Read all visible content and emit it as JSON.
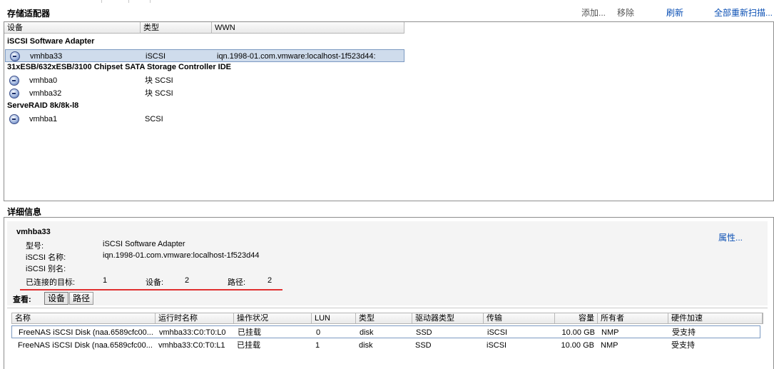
{
  "adapters_section": {
    "title": "存储适配器",
    "actions": {
      "add": "添加...",
      "remove": "移除",
      "refresh": "刷新",
      "rescan_all": "全部重新扫描..."
    },
    "columns": {
      "device": "设备",
      "type": "类型",
      "wwn": "WWN"
    },
    "groups": [
      {
        "name": "iSCSI Software Adapter",
        "rows": [
          {
            "device": "vmhba33",
            "type": "iSCSI",
            "wwn": "iqn.1998-01.com.vmware:localhost-1f523d44:"
          }
        ]
      },
      {
        "name": "31xESB/632xESB/3100 Chipset SATA Storage Controller IDE",
        "rows": [
          {
            "device": "vmhba0",
            "type": "块 SCSI",
            "wwn": ""
          },
          {
            "device": "vmhba32",
            "type": "块 SCSI",
            "wwn": ""
          }
        ]
      },
      {
        "name": "ServeRAID 8k/8k-l8",
        "rows": [
          {
            "device": "vmhba1",
            "type": "SCSI",
            "wwn": ""
          }
        ]
      }
    ]
  },
  "details_section": {
    "title": "详细信息",
    "adapter_name": "vmhba33",
    "properties_link": "属性...",
    "model_label": "型号:",
    "model_value": "iSCSI Software Adapter",
    "iscsi_name_label": "iSCSI 名称:",
    "iscsi_name_value": "iqn.1998-01.com.vmware:localhost-1f523d44",
    "iscsi_alias_label": "iSCSI 别名:",
    "connected_targets_label": "已连接的目标:",
    "connected_targets_value": "1",
    "devices_label": "设备:",
    "devices_value": "2",
    "paths_label": "路径:",
    "paths_value": "2",
    "view_label": "查看:",
    "view_buttons": {
      "devices": "设备",
      "paths": "路径"
    },
    "grid": {
      "columns": {
        "name": "名称",
        "runtime_name": "运行时名称",
        "status": "操作状况",
        "lun": "LUN",
        "type": "类型",
        "drive_type": "驱动器类型",
        "transport": "传输",
        "capacity": "容量",
        "owner": "所有者",
        "hw_accel": "硬件加速"
      },
      "rows": [
        {
          "name": "FreeNAS iSCSI Disk (naa.6589cfc00...",
          "runtime_name": "vmhba33:C0:T0:L0",
          "status": "已挂载",
          "lun": "0",
          "type": "disk",
          "drive_type": "SSD",
          "transport": "iSCSI",
          "capacity": "10.00 GB",
          "owner": "NMP",
          "hw_accel": "受支持"
        },
        {
          "name": "FreeNAS iSCSI Disk (naa.6589cfc00...",
          "runtime_name": "vmhba33:C0:T0:L1",
          "status": "已挂载",
          "lun": "1",
          "type": "disk",
          "drive_type": "SSD",
          "transport": "iSCSI",
          "capacity": "10.00 GB",
          "owner": "NMP",
          "hw_accel": "受支持"
        }
      ]
    }
  },
  "icons": {
    "adapter": "hba-adapter-icon"
  }
}
